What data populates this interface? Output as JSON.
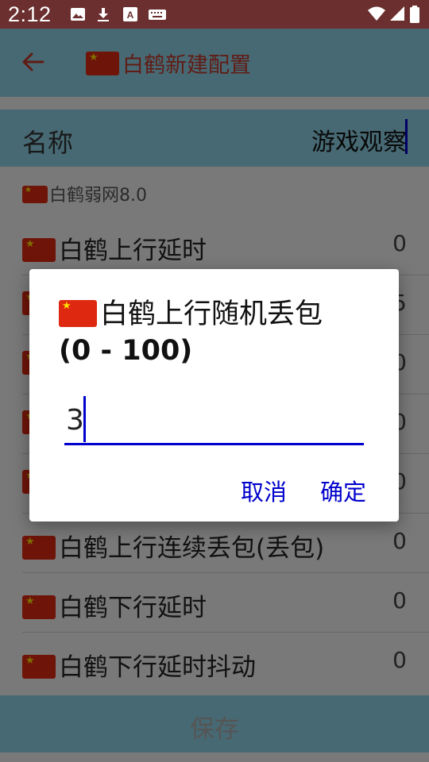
{
  "status_bar": {
    "time": "2:12",
    "icons": [
      "image-icon",
      "download-icon",
      "a-icon",
      "keyboard-icon",
      "wifi-icon",
      "signal-icon",
      "battery-icon"
    ]
  },
  "app_bar": {
    "title": "白鹤新建配置",
    "back_icon": "arrow-left-icon"
  },
  "name_field": {
    "label": "名称",
    "value": "游戏观察"
  },
  "section": {
    "title": "白鹤弱网8.0"
  },
  "rows": [
    {
      "label": "白鹤上行延时",
      "value": "0"
    },
    {
      "label": "",
      "value": "5"
    },
    {
      "label": "",
      "value": "0"
    },
    {
      "label": "",
      "value": "0"
    },
    {
      "label": "",
      "value": "0"
    },
    {
      "label": "白鹤上行连续丢包(丢包)",
      "value": "0"
    },
    {
      "label": "白鹤下行延时",
      "value": "0"
    },
    {
      "label": "白鹤下行延时抖动",
      "value": "0"
    }
  ],
  "save_button": {
    "label": "保存"
  },
  "dialog": {
    "title": "白鹤上行随机丢包",
    "range": "(0 - 100)",
    "input_value": "3",
    "cancel_label": "取消",
    "ok_label": "确定"
  },
  "colors": {
    "status_bar": "#6b2f2f",
    "app_bar": "#8fd3e6",
    "title_red": "#c0392b",
    "accent_blue": "#0000cc",
    "flag_red": "#de2910"
  }
}
